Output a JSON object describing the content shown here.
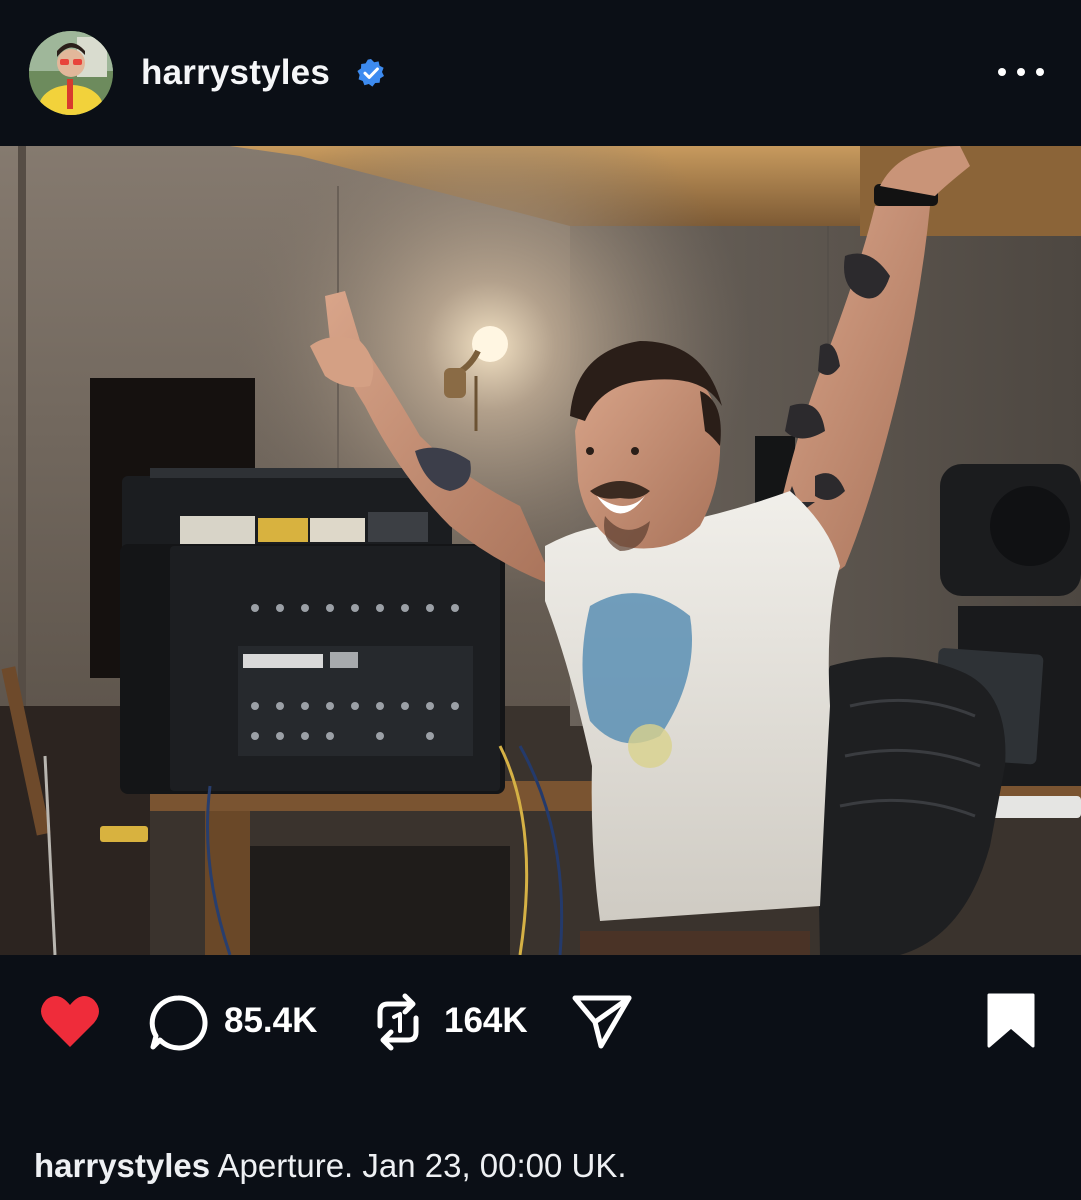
{
  "header": {
    "username": "harrystyles",
    "verified": true,
    "avatar_icon": "profile-avatar",
    "more_icon": "more-horizontal-icon"
  },
  "post": {
    "image_description_icon": "post-photo"
  },
  "actions": {
    "liked": true,
    "like_color": "#ef2c3a",
    "comments_count": "85.4K",
    "reposts_count": "164K"
  },
  "caption": {
    "username": "harrystyles",
    "text": "Aperture. Jan 23, 00:00 UK."
  },
  "colors": {
    "background": "#0b0f16",
    "verified_blue": "#3d8bf0",
    "text": "#ffffff"
  }
}
